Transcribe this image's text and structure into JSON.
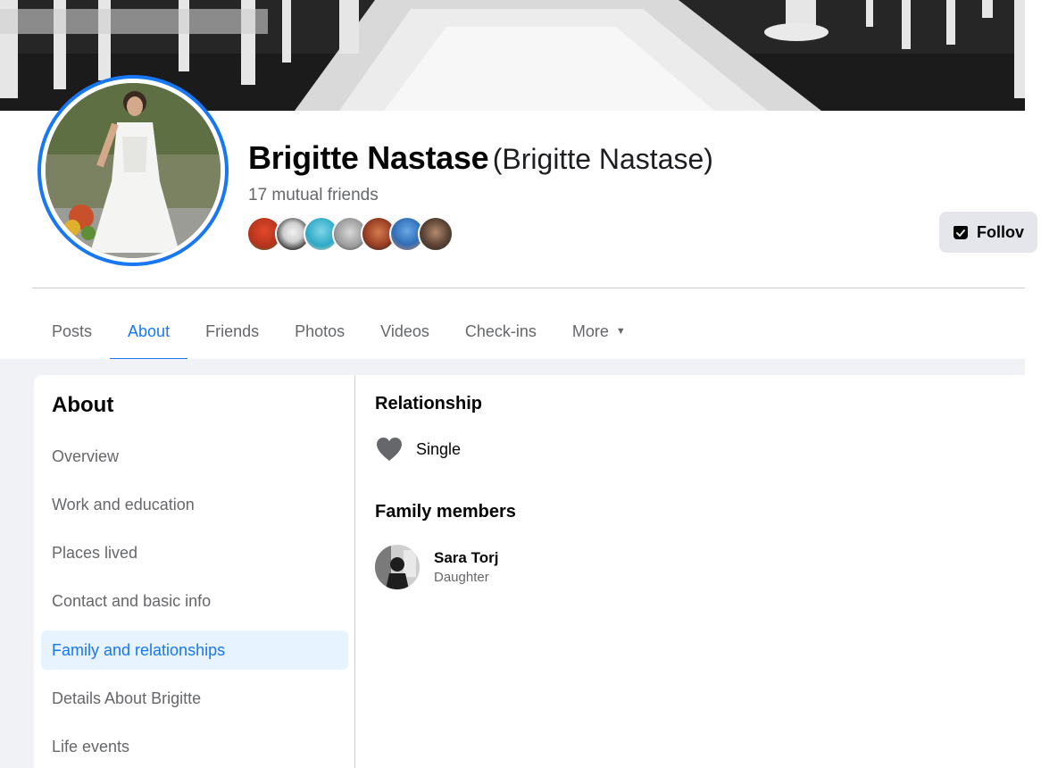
{
  "profile": {
    "name": "Brigitte Nastase",
    "alt_name": "(Brigitte Nastase)",
    "mutual_friends": "17 mutual friends",
    "follow_label": "Follov"
  },
  "tabs": [
    {
      "label": "Posts"
    },
    {
      "label": "About"
    },
    {
      "label": "Friends"
    },
    {
      "label": "Photos"
    },
    {
      "label": "Videos"
    },
    {
      "label": "Check-ins"
    },
    {
      "label": "More"
    }
  ],
  "about": {
    "title": "About",
    "menu": [
      {
        "label": "Overview"
      },
      {
        "label": "Work and education"
      },
      {
        "label": "Places lived"
      },
      {
        "label": "Contact and basic info"
      },
      {
        "label": "Family and relationships"
      },
      {
        "label": "Details About Brigitte"
      },
      {
        "label": "Life events"
      }
    ]
  },
  "relationship": {
    "heading": "Relationship",
    "status": "Single"
  },
  "family": {
    "heading": "Family members",
    "members": [
      {
        "name": "Sara Torj",
        "role": "Daughter"
      }
    ]
  },
  "colors": {
    "accent": "#1877f2",
    "secondary_text": "#65676b",
    "page_background": "#f0f2f5",
    "active_menu_background": "#e7f3ff"
  }
}
